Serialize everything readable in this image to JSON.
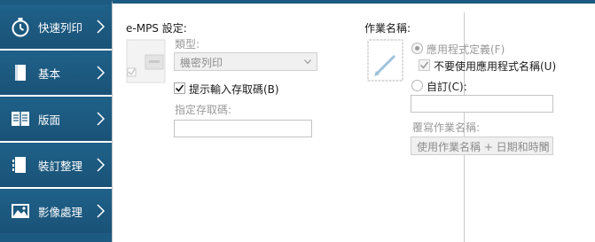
{
  "sidebar": {
    "items": [
      {
        "label": "快速列印",
        "icon": "stopwatch-icon"
      },
      {
        "label": "基本",
        "icon": "document-icon"
      },
      {
        "label": "版面",
        "icon": "layout-icon"
      },
      {
        "label": "裝訂整理",
        "icon": "binding-icon"
      },
      {
        "label": "影像處理",
        "icon": "image-icon"
      }
    ]
  },
  "emps": {
    "title": "e-MPS 設定:",
    "type_label": "類型:",
    "type_value": "機密列印",
    "prompt_checkbox_label": "提示輸入存取碼(B)",
    "prompt_checked": true,
    "access_code_label": "指定存取碼:",
    "access_code_value": ""
  },
  "jobname": {
    "title": "作業名稱:",
    "app_defined_label": "應用程式定義(F)",
    "app_defined_selected": true,
    "no_app_name_label": "不要使用應用程式名稱(U)",
    "no_app_name_checked": true,
    "custom_label": "自訂(C):",
    "custom_value": "",
    "overwrite_label": "覆寫作業名稱:",
    "overwrite_value": "使用作業名稱 + 日期和時間"
  },
  "colors": {
    "sidebar": "#1d5a82",
    "accent_bar": "#1d5a82",
    "disabled_text": "#9a9a9a"
  }
}
